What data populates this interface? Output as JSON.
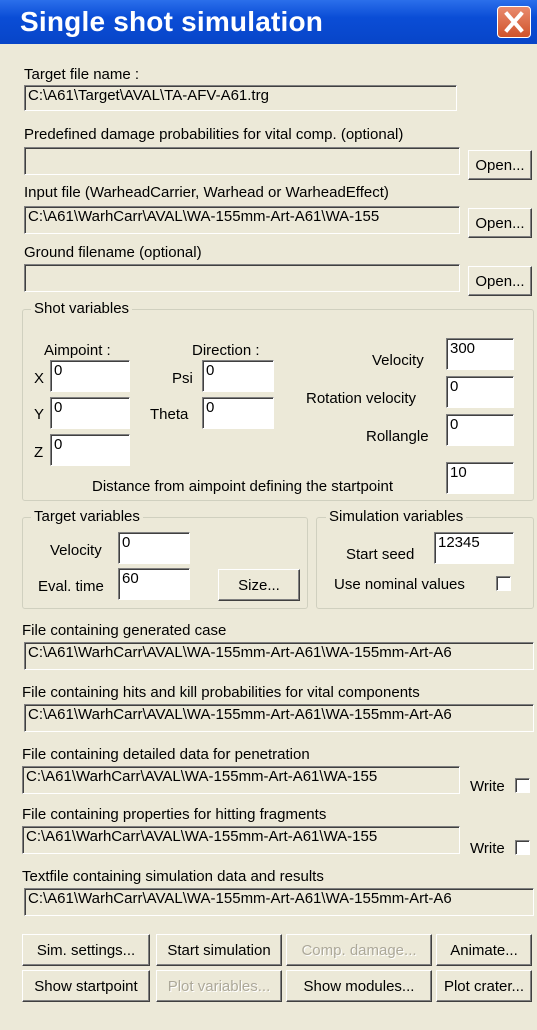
{
  "window": {
    "title": "Single shot simulation"
  },
  "target_file": {
    "label": "Target file name :",
    "value": "C:\\A61\\Target\\AVAL\\TA-AFV-A61.trg"
  },
  "predefined": {
    "label": "Predefined damage probabilities for vital comp. (optional)",
    "value": "",
    "open_label": "Open..."
  },
  "input_file": {
    "label": "Input file (WarheadCarrier, Warhead or WarheadEffect)",
    "value": "C:\\A61\\WarhCarr\\AVAL\\WA-155mm-Art-A61\\WA-155",
    "open_label": "Open..."
  },
  "ground_file": {
    "label": "Ground filename (optional)",
    "value": "",
    "open_label": "Open..."
  },
  "shot_variables": {
    "title": "Shot variables",
    "aimpoint_label": "Aimpoint :",
    "x_label": "X",
    "x_value": "0",
    "y_label": "Y",
    "y_value": "0",
    "z_label": "Z",
    "z_value": "0",
    "direction_label": "Direction :",
    "psi_label": "Psi",
    "psi_value": "0",
    "theta_label": "Theta",
    "theta_value": "0",
    "velocity_label": "Velocity",
    "velocity_value": "300",
    "rotation_label": "Rotation velocity",
    "rotation_value": "0",
    "rollangle_label": "Rollangle",
    "rollangle_value": "0",
    "distance_label": "Distance from aimpoint defining the startpoint",
    "distance_value": "10"
  },
  "target_variables": {
    "title": "Target variables",
    "velocity_label": "Velocity",
    "velocity_value": "0",
    "evaltime_label": "Eval. time",
    "evaltime_value": "60",
    "size_label": "Size..."
  },
  "simulation_variables": {
    "title": "Simulation variables",
    "seed_label": "Start seed",
    "seed_value": "12345",
    "nominal_label": "Use nominal values"
  },
  "generated_case": {
    "label": "File containing generated case",
    "value": "C:\\A61\\WarhCarr\\AVAL\\WA-155mm-Art-A61\\WA-155mm-Art-A6"
  },
  "hits_file": {
    "label": "File containing hits and kill probabilities for vital components",
    "value": "C:\\A61\\WarhCarr\\AVAL\\WA-155mm-Art-A61\\WA-155mm-Art-A6"
  },
  "penetration_file": {
    "label": "File containing detailed data for penetration",
    "value": "C:\\A61\\WarhCarr\\AVAL\\WA-155mm-Art-A61\\WA-155",
    "write_label": "Write"
  },
  "fragments_file": {
    "label": "File containing properties for hitting fragments",
    "value": "C:\\A61\\WarhCarr\\AVAL\\WA-155mm-Art-A61\\WA-155",
    "write_label": "Write"
  },
  "textfile": {
    "label": "Textfile containing simulation data and results",
    "value": "C:\\A61\\WarhCarr\\AVAL\\WA-155mm-Art-A61\\WA-155mm-Art-A6"
  },
  "buttons": {
    "sim_settings": "Sim. settings...",
    "start_simulation": "Start simulation",
    "comp_damage": "Comp. damage...",
    "animate": "Animate...",
    "show_startpoint": "Show startpoint",
    "plot_variables": "Plot variables...",
    "show_modules": "Show modules...",
    "plot_crater": "Plot crater..."
  }
}
